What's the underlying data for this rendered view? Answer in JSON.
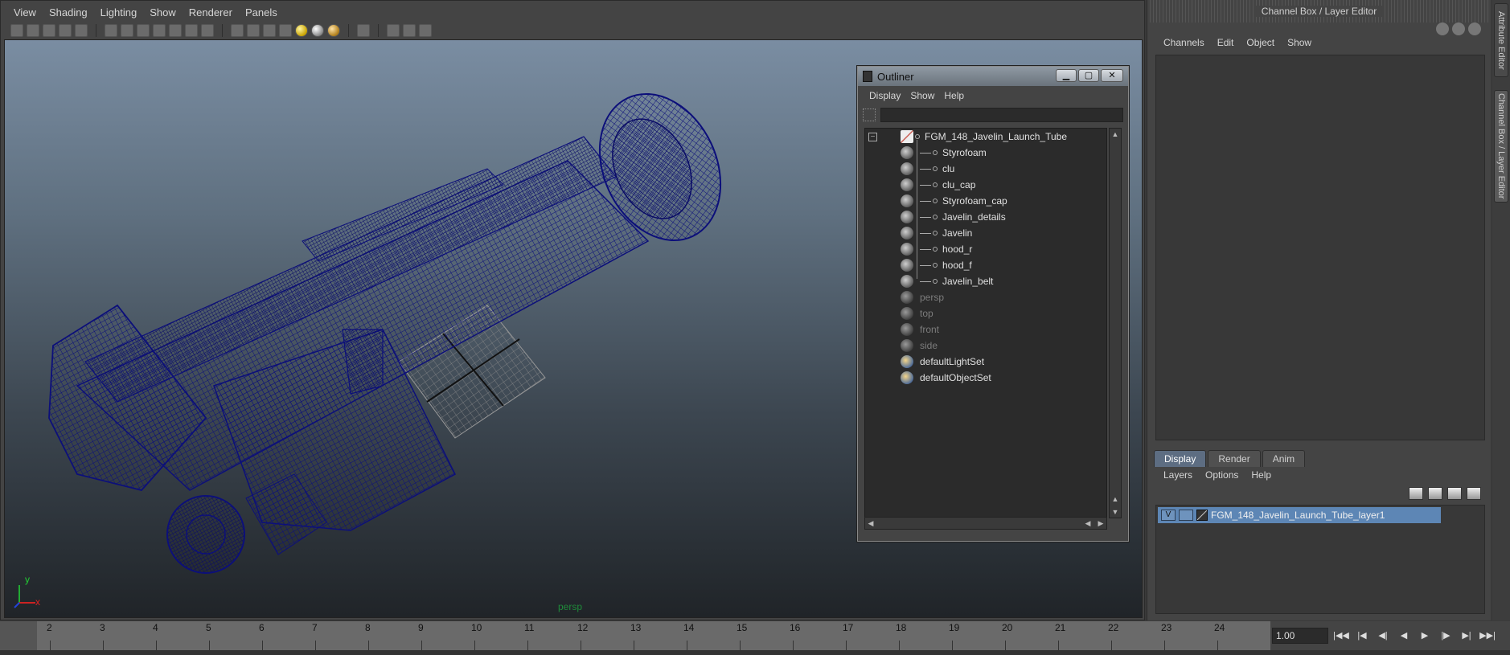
{
  "viewport_panel": {
    "menus": [
      "View",
      "Shading",
      "Lighting",
      "Show",
      "Renderer",
      "Panels"
    ],
    "camera_label": "persp",
    "axis": {
      "y": "y",
      "x": "x"
    }
  },
  "outliner": {
    "title": "Outliner",
    "menus": [
      "Display",
      "Show",
      "Help"
    ],
    "filter_value": "",
    "items": [
      {
        "label": "FGM_148_Javelin_Launch_Tube",
        "kind": "group",
        "level": 0
      },
      {
        "label": "Styrofoam",
        "kind": "mesh",
        "level": 1
      },
      {
        "label": "clu",
        "kind": "mesh",
        "level": 1
      },
      {
        "label": "clu_cap",
        "kind": "mesh",
        "level": 1
      },
      {
        "label": "Styrofoam_cap",
        "kind": "mesh",
        "level": 1
      },
      {
        "label": "Javelin_details",
        "kind": "mesh",
        "level": 1
      },
      {
        "label": "Javelin",
        "kind": "mesh",
        "level": 1
      },
      {
        "label": "hood_r",
        "kind": "mesh",
        "level": 1
      },
      {
        "label": "hood_f",
        "kind": "mesh",
        "level": 1
      },
      {
        "label": "Javelin_belt",
        "kind": "mesh",
        "level": 1
      },
      {
        "label": "persp",
        "kind": "camera",
        "level": 0
      },
      {
        "label": "top",
        "kind": "camera",
        "level": 0
      },
      {
        "label": "front",
        "kind": "camera",
        "level": 0
      },
      {
        "label": "side",
        "kind": "camera",
        "level": 0
      },
      {
        "label": "defaultLightSet",
        "kind": "set",
        "level": 0
      },
      {
        "label": "defaultObjectSet",
        "kind": "set",
        "level": 0
      }
    ]
  },
  "channel_box": {
    "title": "Channel Box / Layer Editor",
    "menus": [
      "Channels",
      "Edit",
      "Object",
      "Show"
    ]
  },
  "layer_editor": {
    "tabs": [
      "Display",
      "Render",
      "Anim"
    ],
    "active_tab": "Display",
    "menus": [
      "Layers",
      "Options",
      "Help"
    ],
    "layer": {
      "visible": "V",
      "name": "FGM_148_Javelin_Launch_Tube_layer1"
    }
  },
  "side_tabs": [
    "Attribute Editor",
    "Channel Box / Layer Editor"
  ],
  "timeline": {
    "ticks": [
      "2",
      "3",
      "4",
      "5",
      "6",
      "7",
      "8",
      "9",
      "10",
      "11",
      "12",
      "13",
      "14",
      "15",
      "16",
      "17",
      "18",
      "19",
      "20",
      "21",
      "22",
      "23",
      "24"
    ],
    "current_frame": "1.00"
  },
  "playback": [
    "|◀◀",
    "|◀",
    "◀|",
    "◀",
    "▶",
    "|▶",
    "▶|",
    "▶▶|"
  ],
  "colors": {
    "wireframe": "#0c0f7a",
    "selection": "#5d86b5"
  }
}
